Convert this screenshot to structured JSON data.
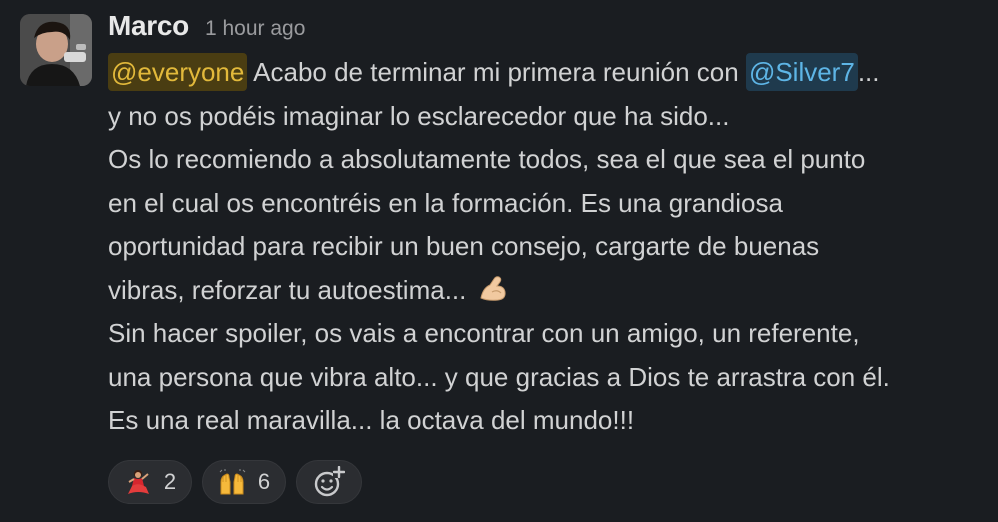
{
  "message": {
    "author": "Marco",
    "timestamp": "1 hour ago",
    "lines": [
      {
        "mention_everyone": "@everyone",
        "text_a": " Acabo de terminar mi primera reunión con ",
        "mention_user": "@Silver7",
        "text_b": "..."
      },
      {
        "text": "y no os podéis imaginar lo esclarecedor que ha sido..."
      },
      {
        "text": "Os lo recomiendo a absolutamente todos, sea el que sea el punto"
      },
      {
        "text": "en el cual os encontréis en la formación. Es una grandiosa"
      },
      {
        "text": "oportunidad para recibir un buen consejo, cargarte de buenas"
      },
      {
        "text": "vibras, reforzar tu autoestima... "
      },
      {
        "text": "Sin hacer spoiler, os vais a encontrar con un amigo, un referente,"
      },
      {
        "text": "una persona que vibra alto... y que gracias a Dios te arrastra con él."
      },
      {
        "text": "Es una real maravilla... la octava del mundo!!!"
      }
    ],
    "inline_emoji": "flexed-biceps-icon"
  },
  "reactions": [
    {
      "emoji": "dancer-icon",
      "count": "2"
    },
    {
      "emoji": "raised-hands-icon",
      "count": "6"
    }
  ],
  "add_reaction_icon": "add-reaction-icon",
  "colors": {
    "background": "#1a1d21",
    "mention_everyone_bg": "#4a3d12",
    "mention_everyone_text": "#e2b93b",
    "mention_user_bg": "#1f3a4d",
    "mention_user_text": "#5eb5e6",
    "reaction_bg": "#2b2d31"
  }
}
